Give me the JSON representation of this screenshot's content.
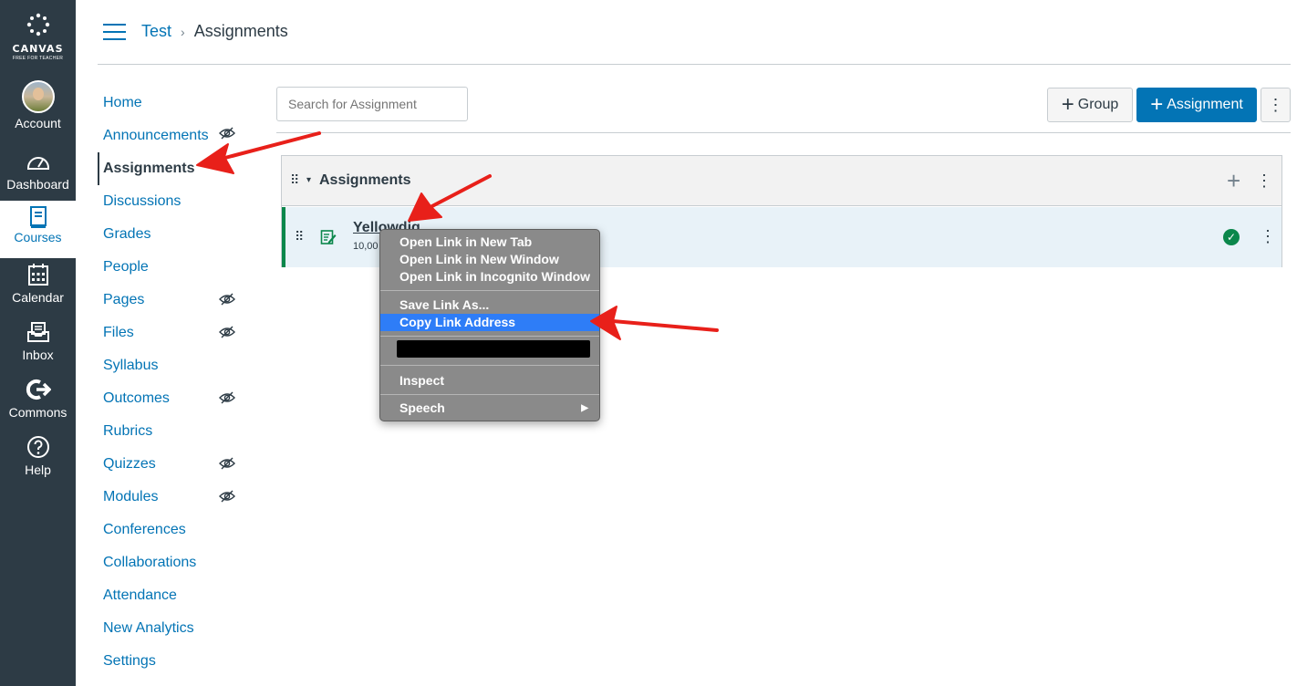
{
  "global_nav": {
    "logo_text": "CANVAS",
    "logo_sub": "FREE FOR TEACHER",
    "items": [
      {
        "label": "Account",
        "icon": "avatar"
      },
      {
        "label": "Dashboard",
        "icon": "dashboard-icon"
      },
      {
        "label": "Courses",
        "icon": "courses-icon"
      },
      {
        "label": "Calendar",
        "icon": "calendar-icon"
      },
      {
        "label": "Inbox",
        "icon": "inbox-icon"
      },
      {
        "label": "Commons",
        "icon": "commons-icon"
      },
      {
        "label": "Help",
        "icon": "help-icon"
      }
    ]
  },
  "breadcrumb": {
    "course": "Test",
    "separator": "›",
    "current": "Assignments"
  },
  "course_nav": {
    "items": [
      {
        "label": "Home"
      },
      {
        "label": "Announcements"
      },
      {
        "label": "Assignments"
      },
      {
        "label": "Discussions"
      },
      {
        "label": "Grades"
      },
      {
        "label": "People"
      },
      {
        "label": "Pages"
      },
      {
        "label": "Files"
      },
      {
        "label": "Syllabus"
      },
      {
        "label": "Outcomes"
      },
      {
        "label": "Rubrics"
      },
      {
        "label": "Quizzes"
      },
      {
        "label": "Modules"
      },
      {
        "label": "Conferences"
      },
      {
        "label": "Collaborations"
      },
      {
        "label": "Attendance"
      },
      {
        "label": "New Analytics"
      },
      {
        "label": "Settings"
      }
    ]
  },
  "toolbar": {
    "search_placeholder": "Search for Assignment",
    "group_label": "Group",
    "assignment_label": "Assignment",
    "plus": "+",
    "kebab": "⋮"
  },
  "group": {
    "title": "Assignments",
    "caret": "▾",
    "add": "+",
    "kebab": "⋮",
    "drag": "⠿"
  },
  "assignment": {
    "title": "Yellowdig",
    "sub": "10,00",
    "check": "✓",
    "kebab": "⋮"
  },
  "context_menu": {
    "items": [
      "Open Link in New Tab",
      "Open Link in New Window",
      "Open Link in Incognito Window",
      "Save Link As...",
      "Copy Link Address",
      "Inspect",
      "Speech"
    ],
    "submenu_arrow": "▶"
  },
  "colors": {
    "nav_bg": "#2d3b45",
    "link": "#0374b5",
    "primary": "#0374b5",
    "published": "#0b874b",
    "menu_highlight": "#2e7df7",
    "annotation": "#e8201a"
  }
}
